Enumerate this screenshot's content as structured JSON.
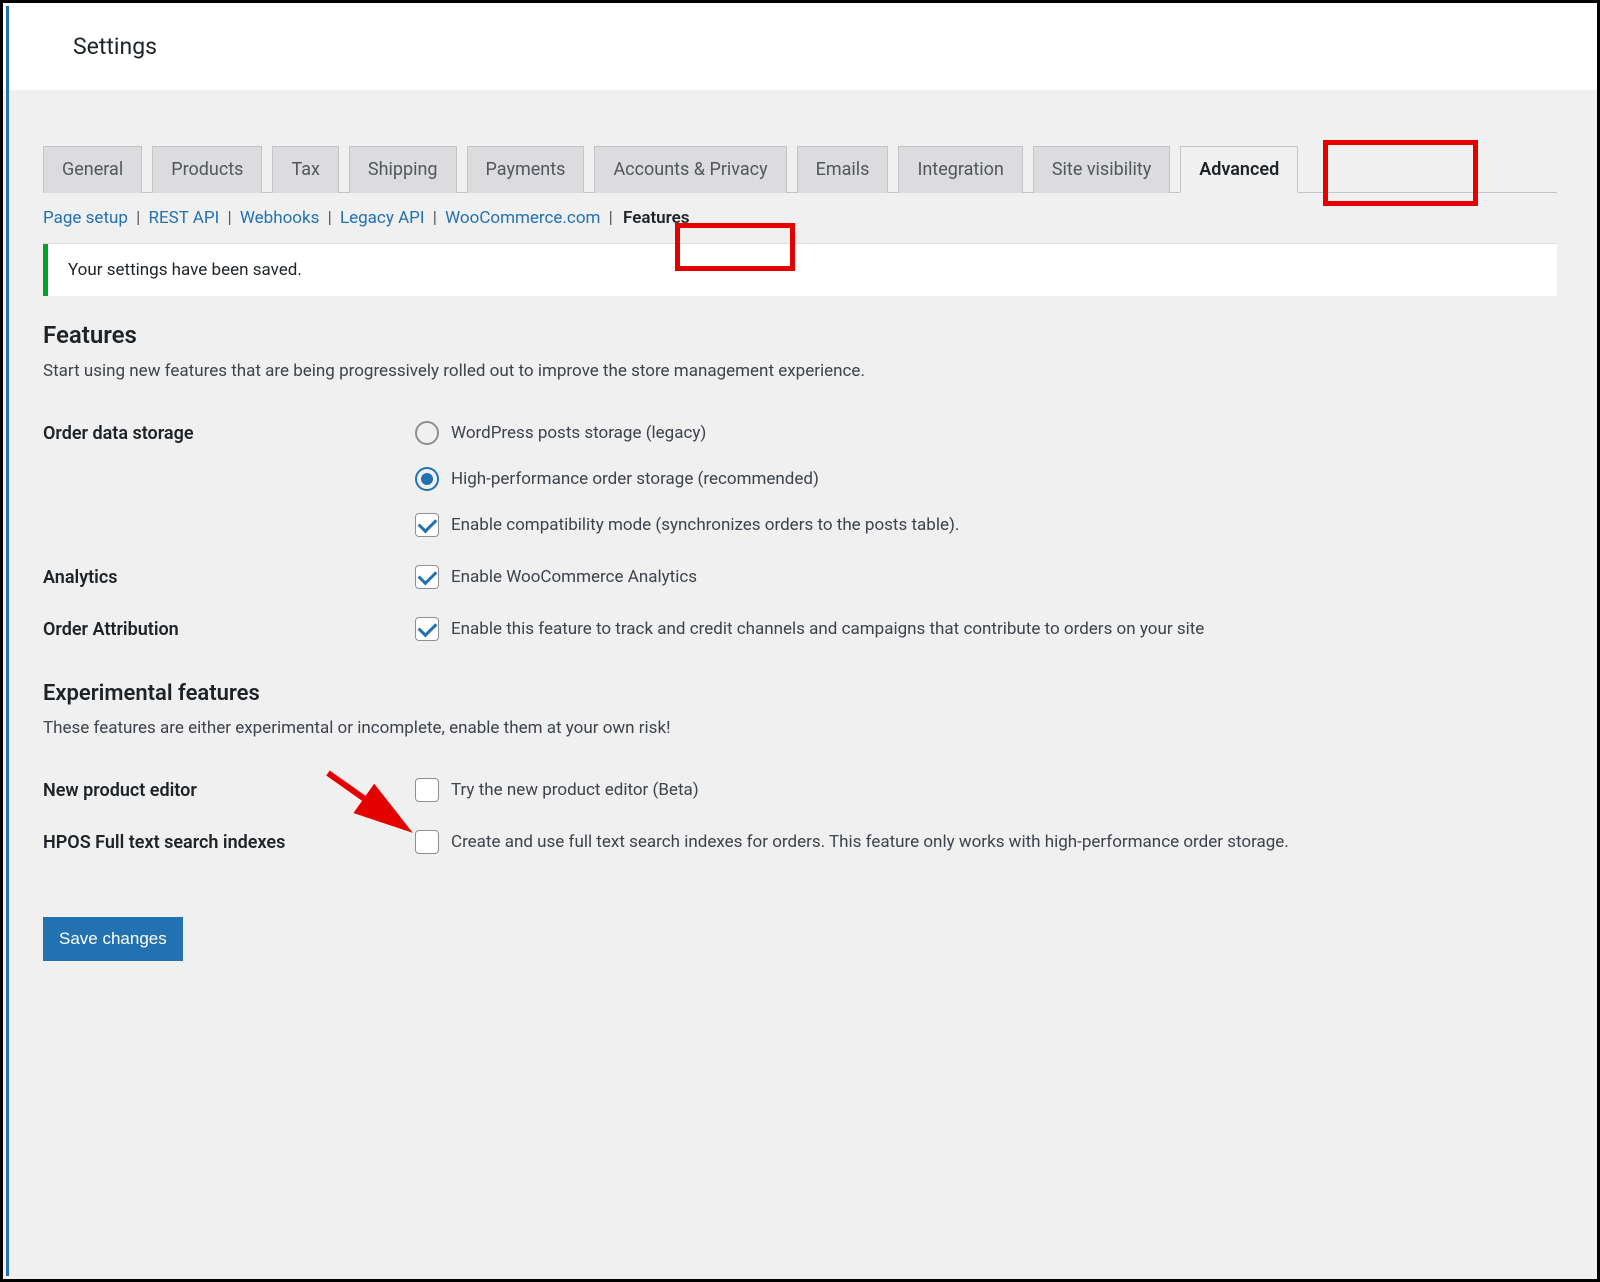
{
  "header": {
    "title": "Settings"
  },
  "tabs": [
    {
      "label": "General",
      "active": false
    },
    {
      "label": "Products",
      "active": false
    },
    {
      "label": "Tax",
      "active": false
    },
    {
      "label": "Shipping",
      "active": false
    },
    {
      "label": "Payments",
      "active": false
    },
    {
      "label": "Accounts & Privacy",
      "active": false
    },
    {
      "label": "Emails",
      "active": false
    },
    {
      "label": "Integration",
      "active": false
    },
    {
      "label": "Site visibility",
      "active": false
    },
    {
      "label": "Advanced",
      "active": true
    }
  ],
  "subtabs": [
    {
      "label": "Page setup",
      "active": false
    },
    {
      "label": "REST API",
      "active": false
    },
    {
      "label": "Webhooks",
      "active": false
    },
    {
      "label": "Legacy API",
      "active": false
    },
    {
      "label": "WooCommerce.com",
      "active": false
    },
    {
      "label": "Features",
      "active": true
    }
  ],
  "notice": "Your settings have been saved.",
  "features": {
    "heading": "Features",
    "desc": "Start using new features that are being progressively rolled out to improve the store management experience."
  },
  "order_storage": {
    "label": "Order data storage",
    "legacy": "WordPress posts storage (legacy)",
    "hpos": "High-performance order storage (recommended)",
    "compat": "Enable compatibility mode (synchronizes orders to the posts table)."
  },
  "analytics": {
    "label": "Analytics",
    "option": "Enable WooCommerce Analytics"
  },
  "attribution": {
    "label": "Order Attribution",
    "option": "Enable this feature to track and credit channels and campaigns that contribute to orders on your site"
  },
  "experimental": {
    "heading": "Experimental features",
    "desc": "These features are either experimental or incomplete, enable them at your own risk!"
  },
  "new_editor": {
    "label": "New product editor",
    "option": "Try the new product editor (Beta)"
  },
  "hpos_fts": {
    "label": "HPOS Full text search indexes",
    "option": "Create and use full text search indexes for orders. This feature only works with high-performance order storage."
  },
  "save_button": "Save changes"
}
